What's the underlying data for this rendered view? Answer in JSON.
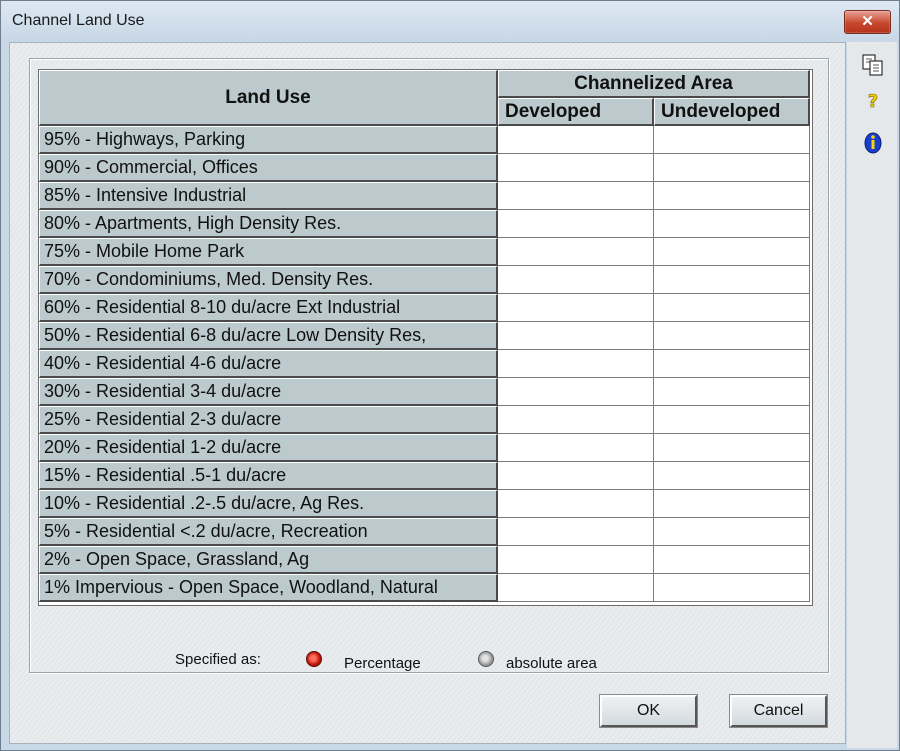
{
  "window": {
    "title": "Channel Land Use",
    "close_label": "✕"
  },
  "sidebar": {
    "icons": [
      "copy-icon",
      "help-icon",
      "info-icon"
    ]
  },
  "table": {
    "row_header_title": "Land Use",
    "group_header": "Channelized Area",
    "columns": [
      "Developed",
      "Undeveloped"
    ],
    "rows": [
      "95% - Highways, Parking",
      "90% - Commercial, Offices",
      "85% - Intensive Industrial",
      "80% - Apartments, High Density Res.",
      "75% - Mobile Home Park",
      "70% - Condominiums, Med. Density Res.",
      "60% - Residential 8-10 du/acre Ext Industrial",
      "50% - Residential 6-8 du/acre Low Density Res,",
      "40% - Residential 4-6 du/acre",
      "30% - Residential 3-4 du/acre",
      "25% - Residential 2-3 du/acre",
      "20% - Residential 1-2 du/acre",
      "15% - Residential .5-1 du/acre",
      "10% - Residential .2-.5 du/acre, Ag Res.",
      "5% - Residential <.2 du/acre, Recreation",
      "2% - Open Space, Grassland, Ag",
      "1% Impervious - Open Space, Woodland, Natural"
    ],
    "values": [
      [
        "",
        ""
      ],
      [
        "",
        ""
      ],
      [
        "",
        ""
      ],
      [
        "",
        ""
      ],
      [
        "",
        ""
      ],
      [
        "",
        ""
      ],
      [
        "",
        ""
      ],
      [
        "",
        ""
      ],
      [
        "",
        ""
      ],
      [
        "",
        ""
      ],
      [
        "",
        ""
      ],
      [
        "",
        ""
      ],
      [
        "",
        ""
      ],
      [
        "",
        ""
      ],
      [
        "",
        ""
      ],
      [
        "",
        ""
      ],
      [
        "",
        ""
      ]
    ]
  },
  "specified": {
    "label": "Specified as:",
    "options": [
      "Percentage",
      "absolute area"
    ],
    "selected": "Percentage"
  },
  "buttons": {
    "ok": "OK",
    "cancel": "Cancel"
  }
}
